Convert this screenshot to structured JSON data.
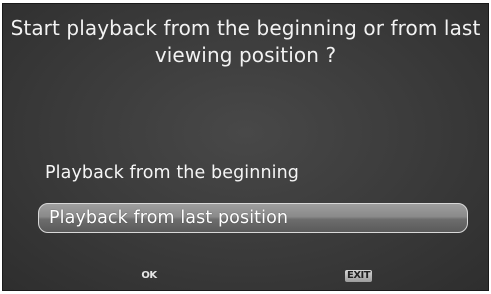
{
  "dialog": {
    "title_line1": "Start playback from the beginning or from last",
    "title_line2": "viewing position ?",
    "options": [
      {
        "label": "Playback from the beginning",
        "selected": false
      },
      {
        "label": "Playback from last position",
        "selected": true
      }
    ]
  },
  "footer": {
    "ok_label": "OK",
    "exit_label": "EXIT"
  },
  "colors": {
    "background": "#3f3f3f",
    "text": "#f2f2f2",
    "highlight": "#8a8a8a"
  }
}
